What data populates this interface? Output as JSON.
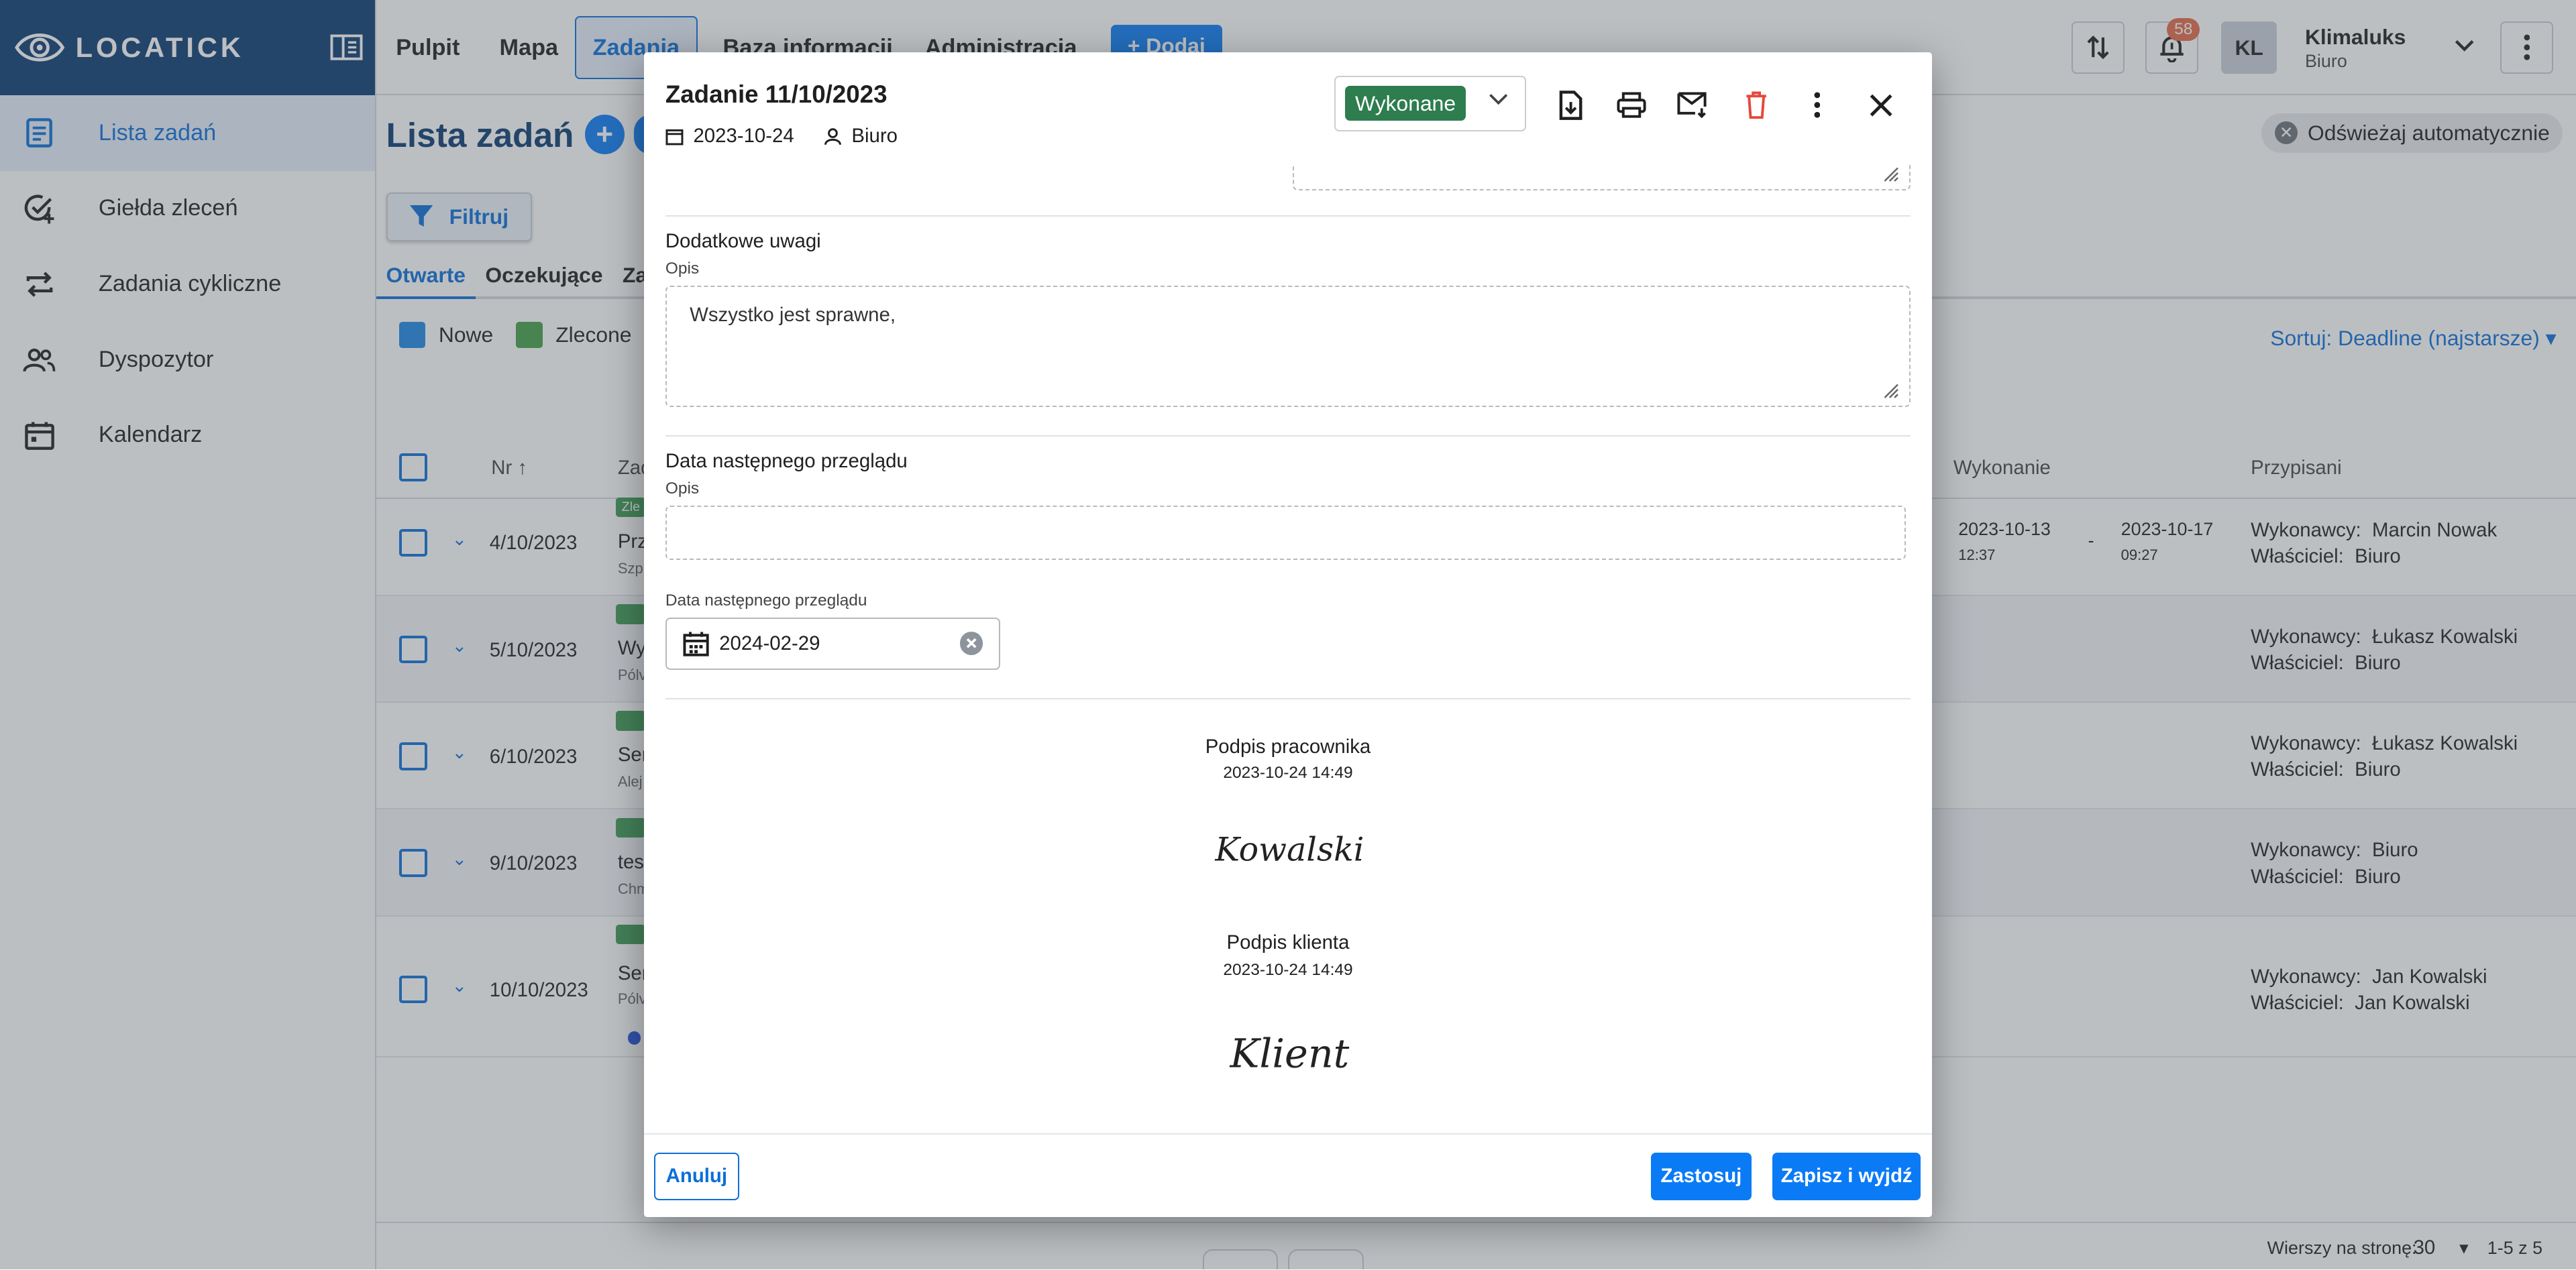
{
  "brand": {
    "name": "LOCATICK"
  },
  "sidebar": {
    "items": [
      {
        "label": "Lista zadań",
        "icon": "list-icon",
        "active": true
      },
      {
        "label": "Giełda zleceń",
        "icon": "check-add-icon"
      },
      {
        "label": "Zadania cykliczne",
        "icon": "repeat-icon"
      },
      {
        "label": "Dyspozytor",
        "icon": "users-icon"
      },
      {
        "label": "Kalendarz",
        "icon": "calendar-icon"
      }
    ]
  },
  "topnav": {
    "items": [
      "Pulpit",
      "Mapa",
      "Zadania",
      "Baza informacji",
      "Administracja"
    ],
    "active": "Zadania",
    "add_label": "+ Dodaj",
    "notif_count": "58",
    "avatar_initials": "KL",
    "company": "Klimaluks",
    "company_sub": "Biuro"
  },
  "page": {
    "title": "Lista zadań",
    "filter_label": "Filtruj",
    "refresh_label": "Odświeżaj automatycznie",
    "tabs": [
      "Otwarte",
      "Oczekujące",
      "Za"
    ],
    "legend": [
      {
        "label": "Nowe",
        "color": "#1e88e5"
      },
      {
        "label": "Zlecone",
        "color": "#43a047"
      },
      {
        "label": "",
        "color": "#e8a23a"
      }
    ],
    "sort_label": "Sortuj: Deadline (najstarsze)",
    "columns": {
      "nr": "Nr",
      "task": "Zad",
      "exec": "Wykonanie",
      "assigned": "Przypisani"
    },
    "rows": [
      {
        "nr": "4/10/2023",
        "title": "Prz",
        "sub": "Szp",
        "exec_start": "2023-10-13",
        "exec_start_time": "12:37",
        "exec_sep": "-",
        "exec_end": "2023-10-17",
        "exec_end_time": "09:27",
        "executor_label": "Wykonawcy:",
        "executor": "Marcin Nowak",
        "owner_label": "Właściciel:",
        "owner": "Biuro"
      },
      {
        "nr": "5/10/2023",
        "title": "Wy",
        "sub": "Pólv",
        "executor_label": "Wykonawcy:",
        "executor": "Łukasz Kowalski",
        "owner_label": "Właściciel:",
        "owner": "Biuro"
      },
      {
        "nr": "6/10/2023",
        "title": "Ser",
        "sub": "Alej",
        "executor_label": "Wykonawcy:",
        "executor": "Łukasz Kowalski",
        "owner_label": "Właściciel:",
        "owner": "Biuro"
      },
      {
        "nr": "9/10/2023",
        "title": "tes",
        "sub": "Chm",
        "executor_label": "Wykonawcy:",
        "executor": "Biuro",
        "owner_label": "Właściciel:",
        "owner": "Biuro"
      },
      {
        "nr": "10/10/2023",
        "title": "Ser",
        "sub": "Pólv",
        "executor_label": "Wykonawcy:",
        "executor": "Jan Kowalski",
        "owner_label": "Właściciel:",
        "owner": "Jan Kowalski"
      }
    ],
    "row_badge": "Zle",
    "footer": {
      "rows_per_page_label": "Wierszy na stronę:",
      "rows_per_page": "30",
      "range": "1-5 z 5"
    }
  },
  "modal": {
    "title": "Zadanie 11/10/2023",
    "date": "2023-10-24",
    "owner": "Biuro",
    "status": "Wykonane",
    "sections": {
      "notes_title": "Dodatkowe uwagi",
      "notes_sub": "Opis",
      "notes_value": "Wszystko jest sprawne,",
      "review_title": "Data następnego przeglądu",
      "review_sub": "Opis",
      "review_value": "",
      "review_date_label": "Data następnego przeglądu",
      "review_date": "2024-02-29"
    },
    "signatures": {
      "worker_label": "Podpis pracownika",
      "worker_date": "2023-10-24 14:49",
      "worker_sig": "Kowalski",
      "client_label": "Podpis klienta",
      "client_date": "2023-10-24 14:49",
      "client_sig": "Klient"
    },
    "footer": {
      "cancel": "Anuluj",
      "apply": "Zastosuj",
      "save_exit": "Zapisz i wyjdź"
    }
  }
}
